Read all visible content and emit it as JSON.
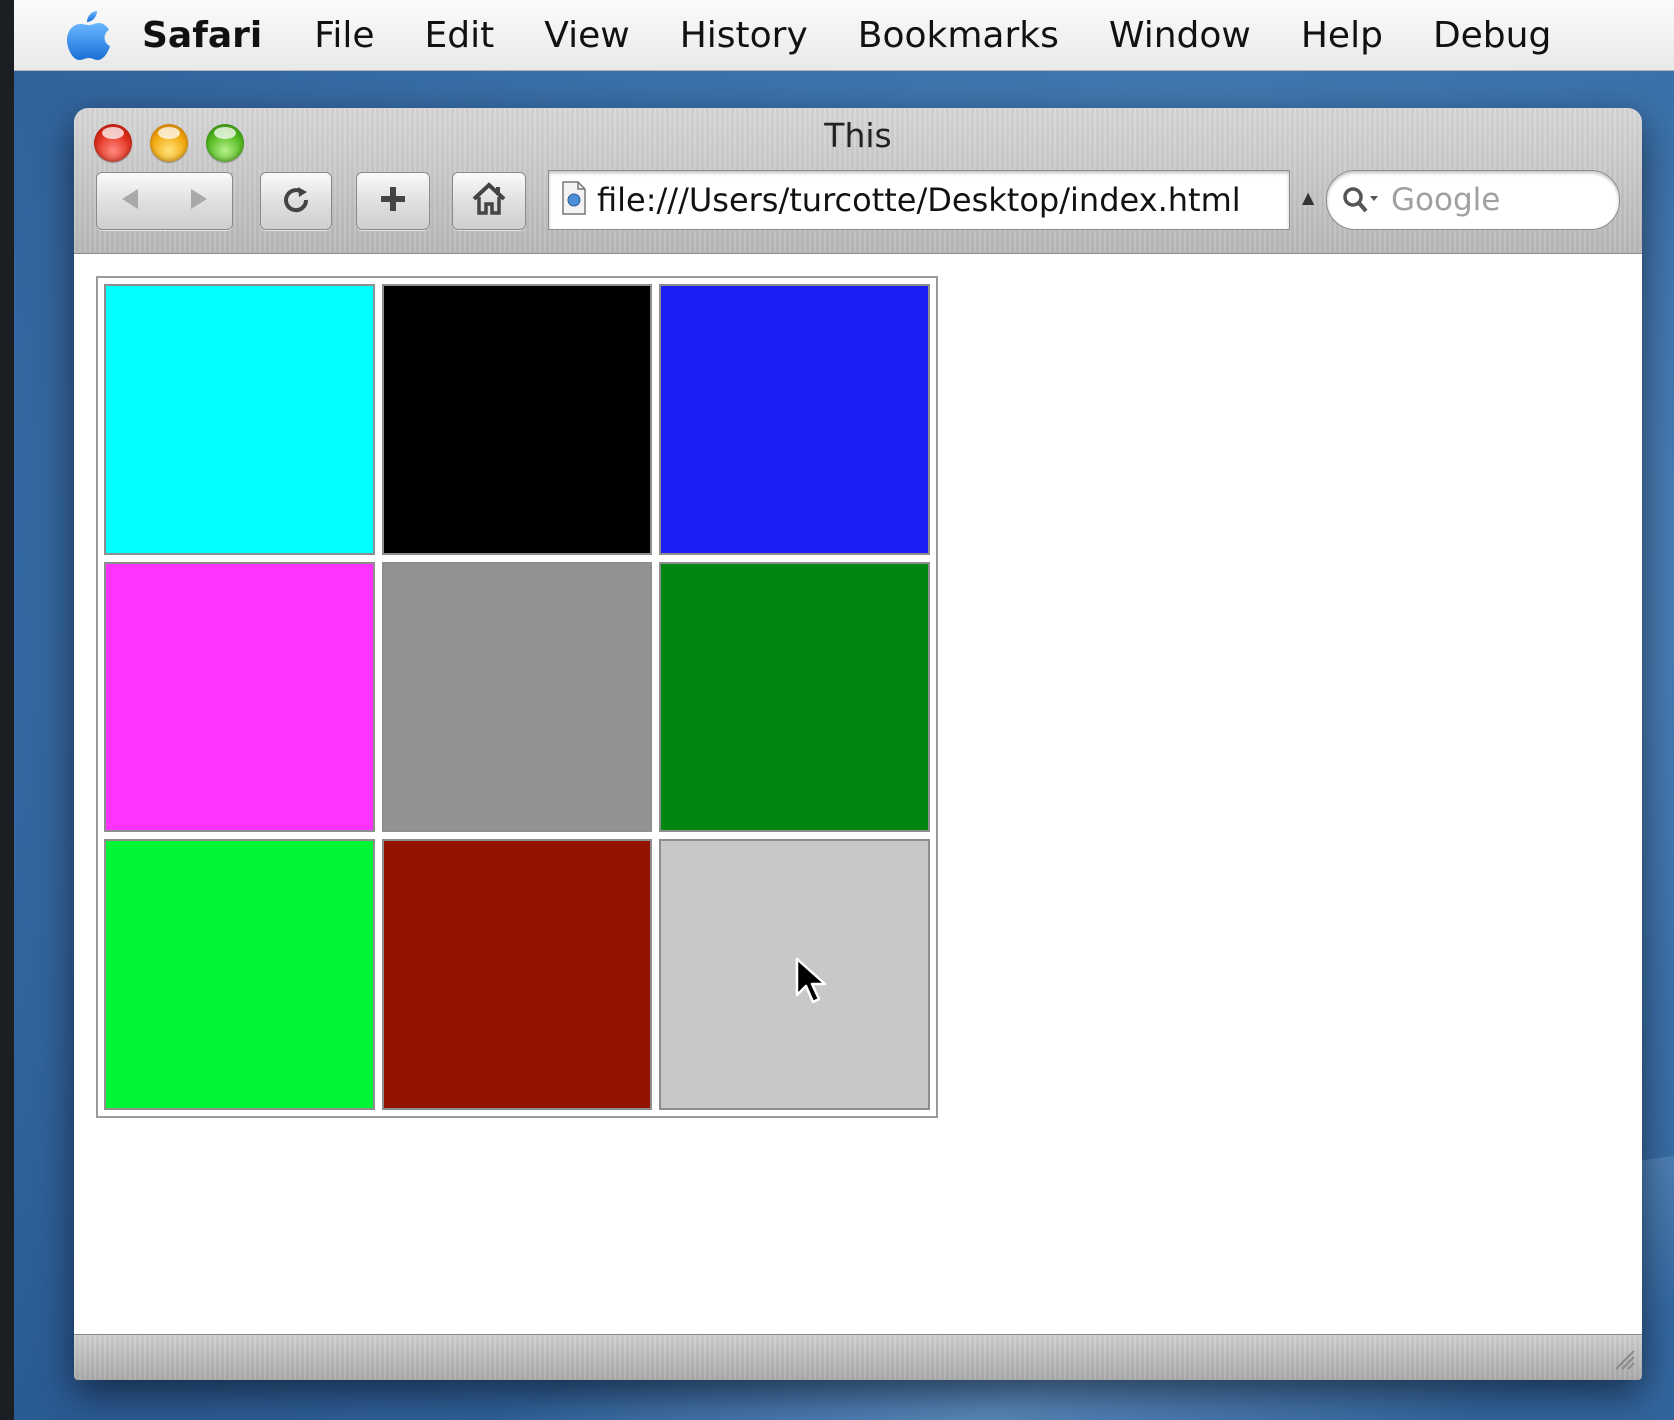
{
  "menubar": {
    "items": [
      "Safari",
      "File",
      "Edit",
      "View",
      "History",
      "Bookmarks",
      "Window",
      "Help",
      "Debug"
    ]
  },
  "window": {
    "title": "This",
    "address": "file:///Users/turcotte/Desktop/index.html",
    "search_placeholder": "Google"
  },
  "icons": {
    "apple": "apple-logo-icon",
    "back": "back-arrow-icon",
    "forward": "forward-arrow-icon",
    "reload": "reload-icon",
    "add": "add-bookmark-icon",
    "home": "home-icon",
    "search": "magnifier-icon"
  },
  "grid": {
    "cells": [
      {
        "name": "cyan",
        "color": "#00FFFF"
      },
      {
        "name": "black",
        "color": "#000000"
      },
      {
        "name": "blue",
        "color": "#1B1EF5"
      },
      {
        "name": "magenta",
        "color": "#FF33FF"
      },
      {
        "name": "gray",
        "color": "#929292"
      },
      {
        "name": "green",
        "color": "#008711"
      },
      {
        "name": "lime",
        "color": "#00F534"
      },
      {
        "name": "maroon",
        "color": "#911300"
      },
      {
        "name": "silver",
        "color": "#C8C8C8"
      }
    ]
  }
}
